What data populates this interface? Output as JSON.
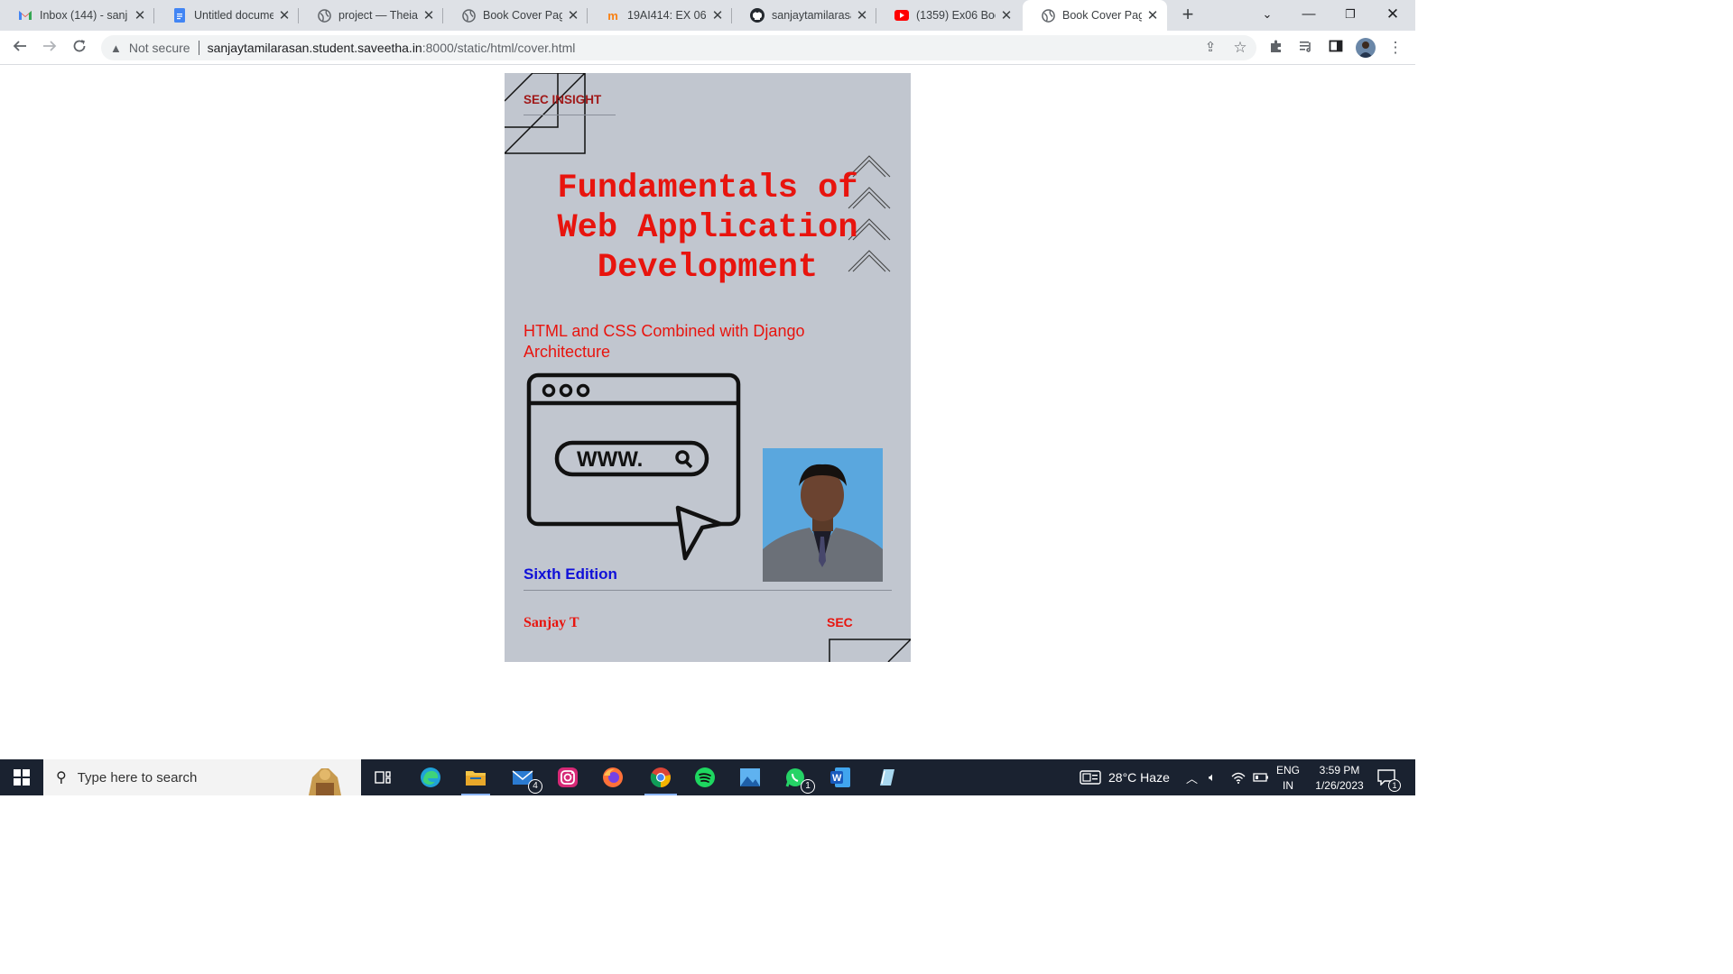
{
  "browser": {
    "tabs": [
      {
        "title": "Inbox (144) - sanj",
        "icon": "gmail-icon"
      },
      {
        "title": "Untitled documen",
        "icon": "docs-icon"
      },
      {
        "title": "project — Theia M",
        "icon": "globe-icon"
      },
      {
        "title": "Book Cover Page",
        "icon": "globe-icon"
      },
      {
        "title": "19AI414: EX 06: B",
        "icon": "moodle-icon"
      },
      {
        "title": "sanjaytamilarasan",
        "icon": "github-icon"
      },
      {
        "title": "(1359) Ex06 Book",
        "icon": "youtube-icon"
      },
      {
        "title": "Book Cover Page",
        "icon": "globe-icon",
        "active": true
      }
    ],
    "omnibox": {
      "security": "Not secure",
      "host": "sanjaytamilarasan.student.saveetha.in",
      "path": ":8000/static/html/cover.html"
    }
  },
  "cover": {
    "brand": "SEC INSIGHT",
    "title_lines": [
      "Fundamentals of",
      "Web Application",
      "Development"
    ],
    "subtitle": "HTML and CSS Combined with Django Architecture",
    "browser_graphic_text": "WWW.",
    "edition": "Sixth Edition",
    "author": "Sanjay T",
    "publisher": "SEC",
    "colors": {
      "background": "#c1c6cf",
      "title": "#e8140e",
      "edition": "#1010d8",
      "brand": "#a01818"
    }
  },
  "taskbar": {
    "search_placeholder": "Type here to search",
    "weather": "28°C  Haze",
    "lang": [
      "ENG",
      "IN"
    ],
    "time": "3:59 PM",
    "date": "1/26/2023",
    "mail_badge": "4",
    "whatsapp_badge": "1",
    "notification_badge": "1"
  }
}
